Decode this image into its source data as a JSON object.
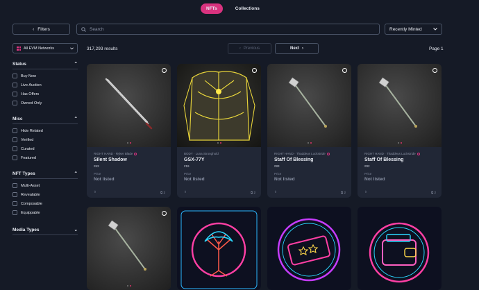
{
  "tabs": [
    {
      "label": "NFTs",
      "active": true
    },
    {
      "label": "Collections",
      "active": false
    }
  ],
  "toolbar": {
    "filters_label": "Filters",
    "search_placeholder": "Search",
    "sort_value": "Recently Minted"
  },
  "network": {
    "label": "All EVM Networks"
  },
  "results": {
    "count_text": "317,293 results",
    "prev_label": "Previous",
    "next_label": "Next",
    "page_text": "Page 1"
  },
  "sidebar": {
    "sections": [
      {
        "title": "Status",
        "options": [
          "Buy Now",
          "Live Auction",
          "Has Offers",
          "Owned Only"
        ]
      },
      {
        "title": "Misc",
        "options": [
          "Hide Related",
          "Verified",
          "Curated",
          "Featured"
        ]
      },
      {
        "title": "NFT Types",
        "options": [
          "Multi-Asset",
          "Revealable",
          "Composable",
          "Equippable"
        ]
      },
      {
        "title": "Media Types",
        "options": []
      }
    ]
  },
  "cards": [
    {
      "sub": "RIGHT HAND · Ryker Blade",
      "name": "Silent Shadow",
      "num": "#63",
      "price_label": "Price",
      "price": "Not listed",
      "count": "2"
    },
    {
      "sub": "BODY · Luna Stronghold",
      "name": "GSX-77Y",
      "num": "#19",
      "price_label": "Price",
      "price": "Not listed",
      "count": "2"
    },
    {
      "sub": "RIGHT HAND · Thaddeus Luckstride",
      "name": "Staff Of Blessing",
      "num": "#83",
      "price_label": "Price",
      "price": "Not listed",
      "count": "2"
    },
    {
      "sub": "RIGHT HAND · Thaddeus Luckstride",
      "name": "Staff Of Blessing",
      "num": "#82",
      "price_label": "Price",
      "price": "Not listed",
      "count": "2"
    }
  ],
  "colors": {
    "accent": "#d9337f",
    "background": "#151a26",
    "card": "#212736"
  }
}
